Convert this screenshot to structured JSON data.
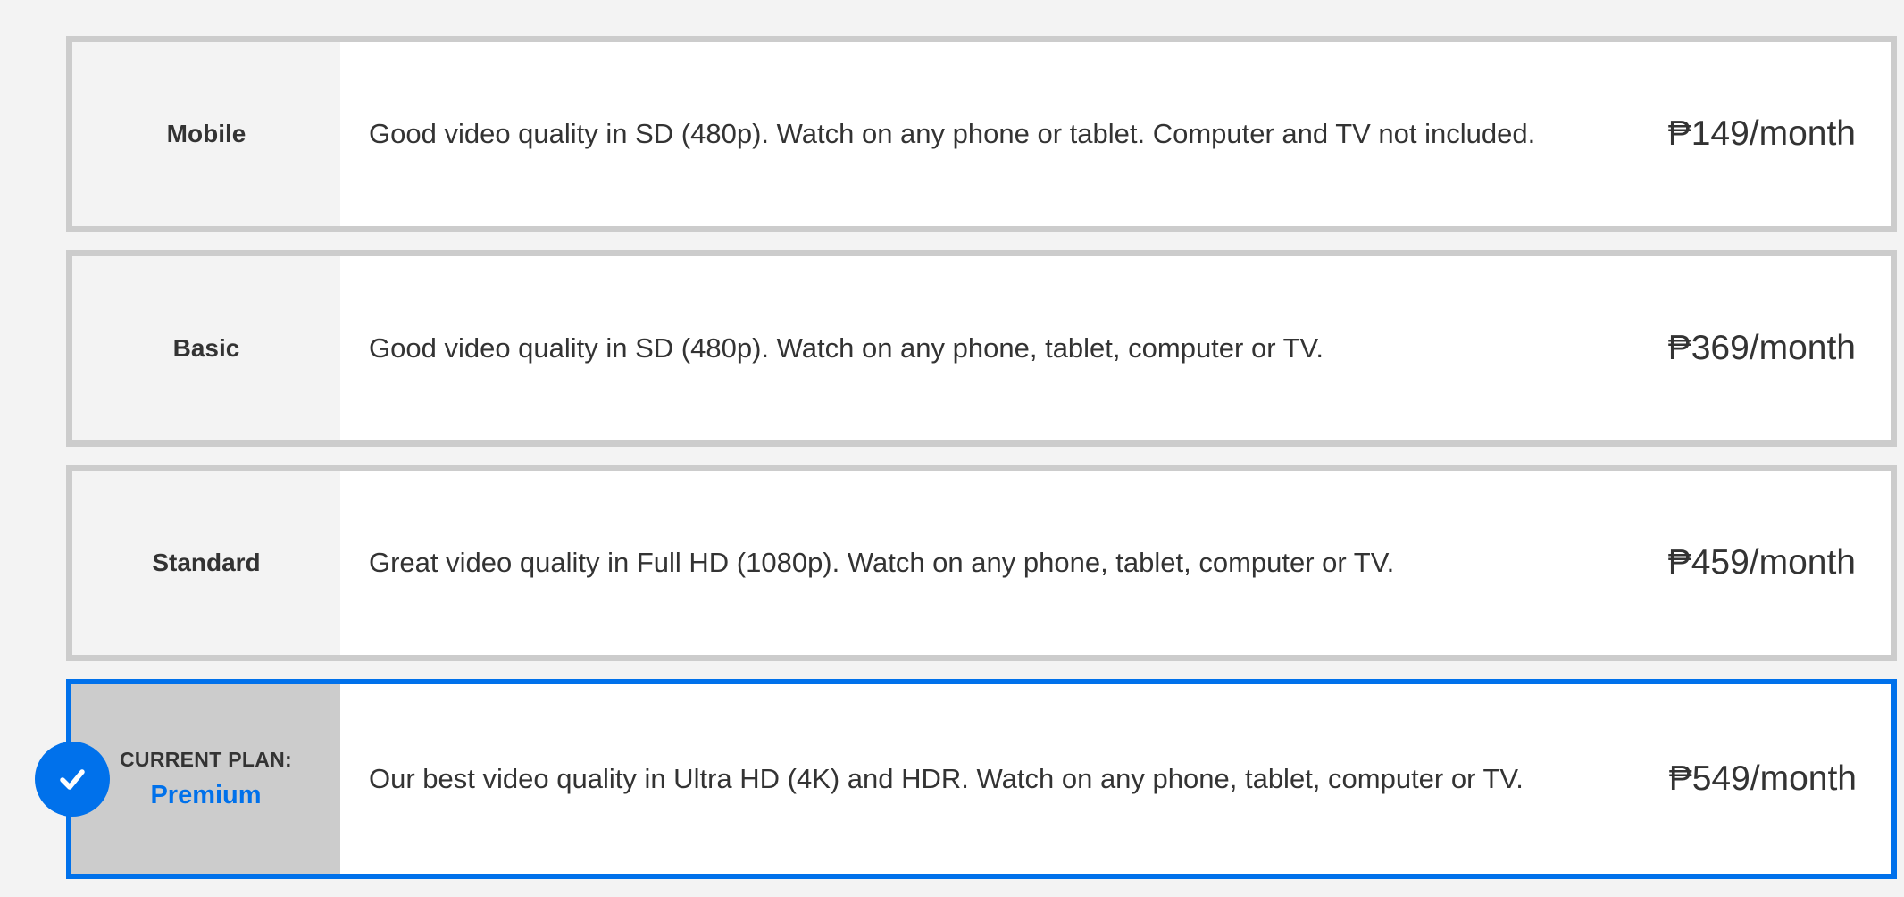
{
  "plans": [
    {
      "name": "Mobile",
      "description": "Good video quality in SD (480p). Watch on any phone or tablet. Computer and TV not included.",
      "price": "₱149/month"
    },
    {
      "name": "Basic",
      "description": "Good video quality in SD (480p). Watch on any phone, tablet, computer or TV.",
      "price": "₱369/month"
    },
    {
      "name": "Standard",
      "description": "Great video quality in Full HD (1080p). Watch on any phone, tablet, computer or TV.",
      "price": "₱459/month"
    },
    {
      "current_label": "CURRENT PLAN:",
      "name": "Premium",
      "description": "Our best video quality in Ultra HD (4K) and HDR. Watch on any phone, tablet, computer or TV.",
      "price": "₱549/month",
      "is_current": true
    }
  ],
  "icons": {
    "selected": "checkmark-icon"
  },
  "colors": {
    "accent": "#0071eb",
    "border": "#cccccc",
    "text": "#333333"
  }
}
